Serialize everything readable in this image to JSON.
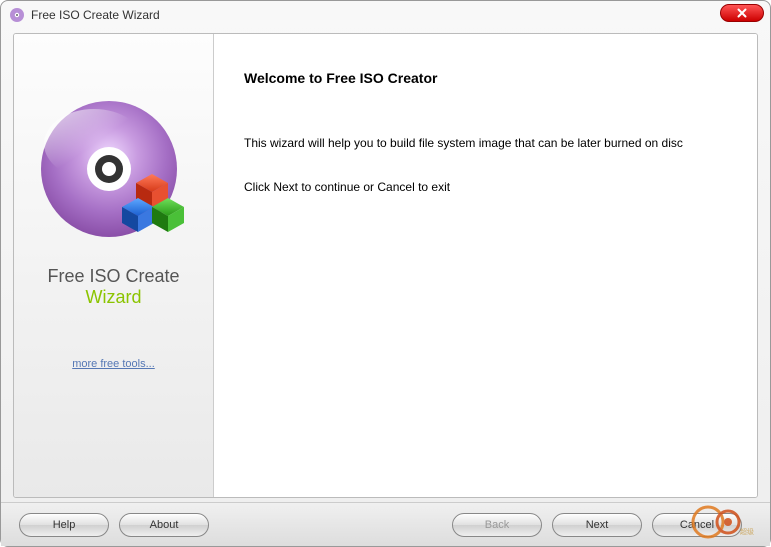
{
  "window": {
    "title": "Free ISO Create Wizard"
  },
  "sidebar": {
    "app_name_line1": "Free ISO Create",
    "app_name_line2": "Wizard",
    "more_tools_link": "more free tools..."
  },
  "main": {
    "heading": "Welcome to Free ISO Creator",
    "body1": "This wizard will help you to build file system image that can be later burned on disc",
    "body2": "Click Next to continue or Cancel to exit"
  },
  "buttons": {
    "help": "Help",
    "about": "About",
    "back": "Back",
    "next": "Next",
    "cancel": "Cancel"
  }
}
